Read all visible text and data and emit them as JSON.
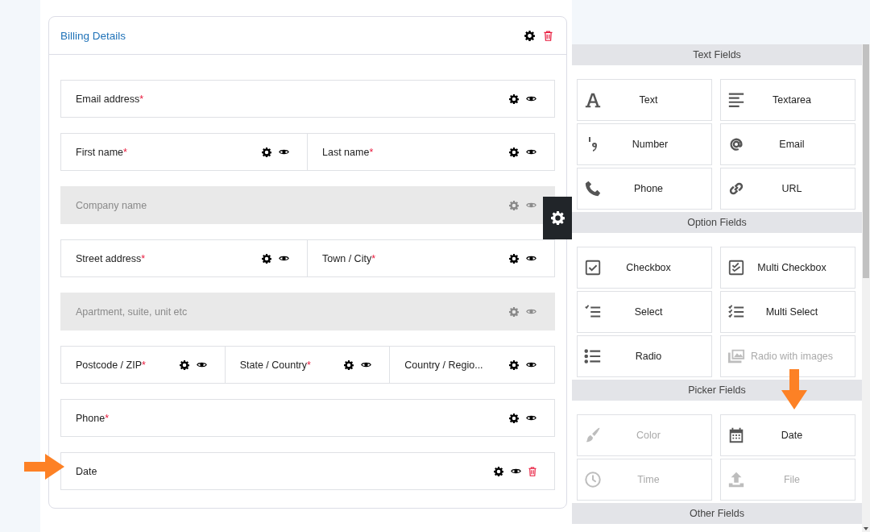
{
  "card": {
    "title": "Billing Details",
    "rows": [
      [
        {
          "label": "Email address",
          "required_mark": "*",
          "disabled": false,
          "deletable": false
        }
      ],
      [
        {
          "label": "First name",
          "required_mark": "*",
          "disabled": false,
          "deletable": false
        },
        {
          "label": "Last name",
          "required_mark": "*",
          "disabled": false,
          "deletable": false
        }
      ],
      [
        {
          "label": "Company name",
          "disabled": true,
          "deletable": false
        }
      ],
      [
        {
          "label": "Street address",
          "required_mark": "*",
          "disabled": false,
          "deletable": false
        },
        {
          "label": "Town / City",
          "required_mark": "*",
          "disabled": false,
          "deletable": false
        }
      ],
      [
        {
          "label": "Apartment, suite, unit etc",
          "disabled": true,
          "deletable": false
        }
      ],
      [
        {
          "label": "Postcode / ZIP",
          "required_mark": "*",
          "disabled": false,
          "deletable": false
        },
        {
          "label": "State / Country",
          "required_mark": "*",
          "disabled": false,
          "deletable": false
        },
        {
          "label": "Country / Regio...",
          "disabled": false,
          "deletable": false
        }
      ],
      [
        {
          "label": "Phone",
          "required_mark": "*",
          "disabled": false,
          "deletable": false
        }
      ],
      [
        {
          "label": "Date",
          "disabled": false,
          "deletable": true
        }
      ]
    ]
  },
  "palette": [
    {
      "title": "Text Fields",
      "items": [
        {
          "label": "Text",
          "disabled": false
        },
        {
          "label": "Textarea",
          "disabled": false
        },
        {
          "label": "Number",
          "disabled": false
        },
        {
          "label": "Email",
          "disabled": false
        },
        {
          "label": "Phone",
          "disabled": false
        },
        {
          "label": "URL",
          "disabled": false
        }
      ]
    },
    {
      "title": "Option Fields",
      "items": [
        {
          "label": "Checkbox",
          "disabled": false
        },
        {
          "label": "Multi Checkbox",
          "disabled": false
        },
        {
          "label": "Select",
          "disabled": false
        },
        {
          "label": "Multi Select",
          "disabled": false
        },
        {
          "label": "Radio",
          "disabled": false
        },
        {
          "label": "Radio with images",
          "disabled": true
        }
      ]
    },
    {
      "title": "Picker Fields",
      "items": [
        {
          "label": "Color",
          "disabled": true
        },
        {
          "label": "Date",
          "disabled": false
        },
        {
          "label": "Time",
          "disabled": true
        },
        {
          "label": "File",
          "disabled": true
        }
      ]
    },
    {
      "title": "Other Fields"
    }
  ]
}
